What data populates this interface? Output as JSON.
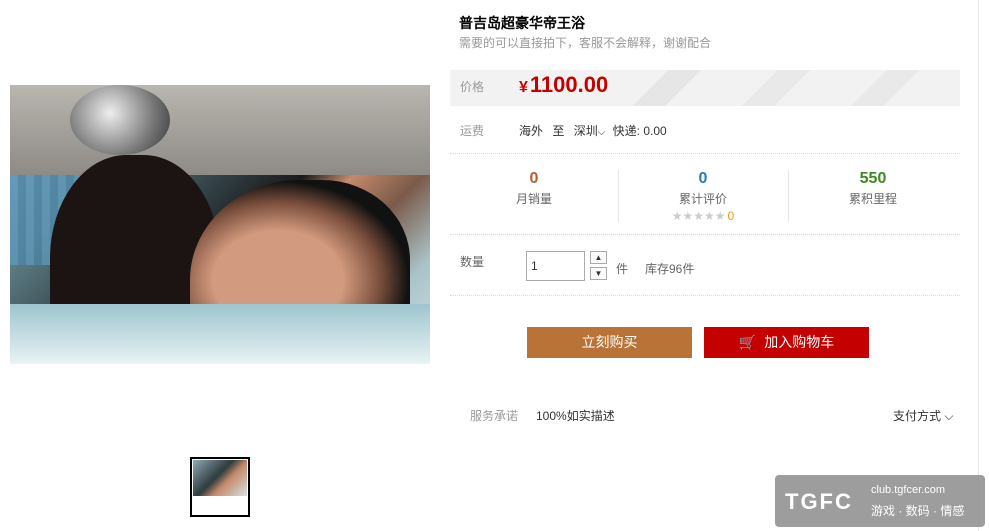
{
  "product": {
    "title": "普吉岛超豪华帝王浴",
    "subtitle": "需要的可以直接拍下，客服不会解释，谢谢配合"
  },
  "price": {
    "label": "价格",
    "currency": "¥",
    "value": "1100.00",
    "color": "#c40000"
  },
  "shipping": {
    "label": "运费",
    "origin": "海外",
    "to": "至",
    "city": "深圳",
    "express": "快递: 0.00"
  },
  "stats": [
    {
      "num": "0",
      "label": "月销量",
      "color": "#b85c2c"
    },
    {
      "num": "0",
      "label": "累计评价",
      "stars": "★★★★★",
      "count": "0",
      "color": "#2a7bb4"
    },
    {
      "num": "550",
      "label": "累积里程",
      "color": "#3c8a1e"
    }
  ],
  "quantity": {
    "label": "数量",
    "value": "1",
    "unit": "件",
    "stock": "库存96件",
    "up": "▲",
    "down": "▼"
  },
  "buttons": {
    "buy": "立刻购买",
    "cart": "加入购物车"
  },
  "service": {
    "label": "服务承诺",
    "value": "100%如实描述",
    "payment": "支付方式",
    "payment_chevron": "⌵"
  },
  "watermark": {
    "logo": "TGFC",
    "domain": "club.tgfcer.com",
    "slogan": "游戏 · 数码 · 情感"
  }
}
